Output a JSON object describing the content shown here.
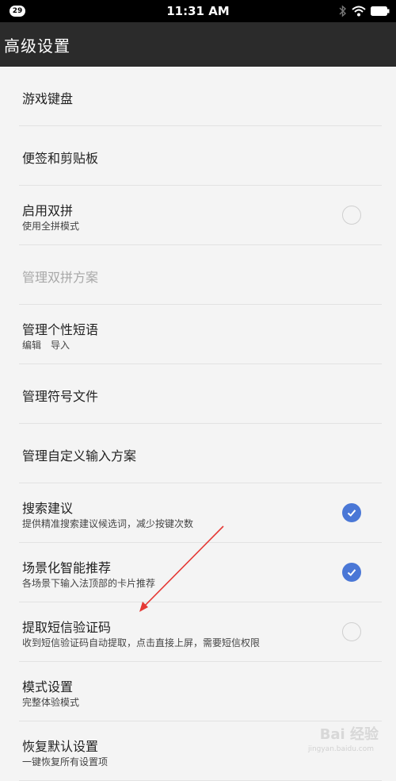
{
  "status_bar": {
    "badge": "29",
    "time": "11:31 AM"
  },
  "header": {
    "title": "高级设置"
  },
  "settings": [
    {
      "title": "游戏键盘"
    },
    {
      "title": "便签和剪贴板"
    },
    {
      "title": "启用双拼",
      "subtitle": "使用全拼模式",
      "checked": false
    },
    {
      "title": "管理双拼方案",
      "disabled": true
    },
    {
      "title": "管理个性短语",
      "subtitle": "编辑　导入"
    },
    {
      "title": "管理符号文件"
    },
    {
      "title": "管理自定义输入方案"
    },
    {
      "title": "搜索建议",
      "subtitle": "提供精准搜索建议候选词，减少按键次数",
      "checked": true
    },
    {
      "title": "场景化智能推荐",
      "subtitle": "各场景下输入法顶部的卡片推荐",
      "checked": true
    },
    {
      "title": "提取短信验证码",
      "subtitle": "收到短信验证码自动提取，点击直接上屏，需要短信权限",
      "checked": false
    },
    {
      "title": "模式设置",
      "subtitle": "完整体验模式"
    },
    {
      "title": "恢复默认设置",
      "subtitle": "一键恢复所有设置项"
    }
  ],
  "watermark": {
    "brand": "Bai 经验",
    "sub": "jingyan.baidu.com"
  },
  "colors": {
    "accent": "#4a77d6",
    "header_bg": "#2b2b2b",
    "annotation": "#e53935"
  }
}
